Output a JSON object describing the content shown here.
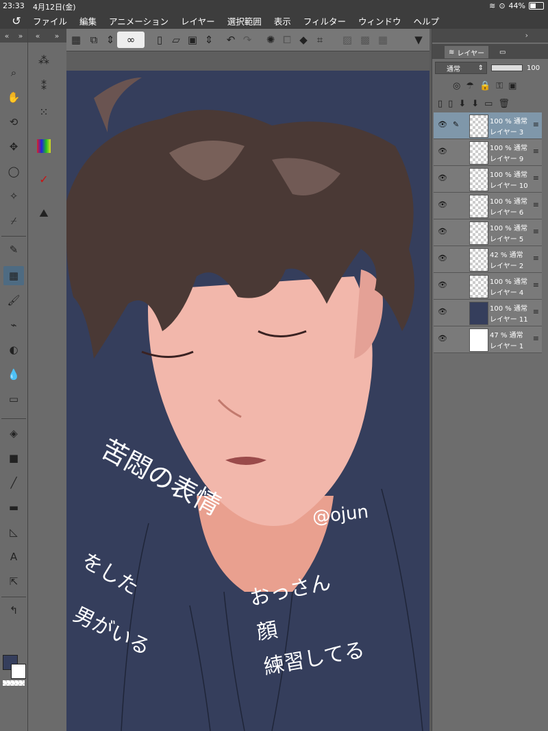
{
  "status": {
    "time": "23:33",
    "date": "4月12日(金)",
    "battery": "44%",
    "battery_level": 0.44
  },
  "menu": [
    "ファイル",
    "編集",
    "アニメーション",
    "レイヤー",
    "選択範囲",
    "表示",
    "フィルター",
    "ウィンドウ",
    "ヘルプ"
  ],
  "layer_panel": {
    "tab_label": "レイヤー",
    "blend_mode": "通常",
    "opacity": "100",
    "layers": [
      {
        "opacity": "100 %",
        "mode": "通常",
        "name": "レイヤー 3",
        "selected": true,
        "thumb": "transparent"
      },
      {
        "opacity": "100 %",
        "mode": "通常",
        "name": "レイヤー 9",
        "selected": false,
        "thumb": "transparent"
      },
      {
        "opacity": "100 %",
        "mode": "通常",
        "name": "レイヤー 10",
        "selected": false,
        "thumb": "transparent"
      },
      {
        "opacity": "100 %",
        "mode": "通常",
        "name": "レイヤー 6",
        "selected": false,
        "thumb": "transparent"
      },
      {
        "opacity": "100 %",
        "mode": "通常",
        "name": "レイヤー 5",
        "selected": false,
        "thumb": "transparent"
      },
      {
        "opacity": "42 %",
        "mode": "通常",
        "name": "レイヤー 2",
        "selected": false,
        "thumb": "transparent"
      },
      {
        "opacity": "100 %",
        "mode": "通常",
        "name": "レイヤー 4",
        "selected": false,
        "thumb": "transparent"
      },
      {
        "opacity": "100 %",
        "mode": "通常",
        "name": "レイヤー 11",
        "selected": false,
        "thumb": "navy"
      },
      {
        "opacity": "47 %",
        "mode": "通常",
        "name": "レイヤー 1",
        "selected": false,
        "thumb": "white"
      }
    ]
  },
  "tool_sidebar": {
    "tools": [
      "zoom-icon",
      "hand-icon",
      "rotate-icon",
      "move-icon",
      "lasso-icon",
      "magic-wand-icon",
      "eyedropper-icon",
      "pen-icon",
      "pattern-icon",
      "brush-icon",
      "airbrush-icon",
      "blend-icon",
      "water-drop-icon",
      "eraser-icon",
      "fill-icon",
      "gradient-icon",
      "line-icon",
      "ruler-icon",
      "triangle-ruler-icon",
      "text-icon",
      "select-object-icon",
      "correct-line-icon"
    ]
  },
  "canvas": {
    "background": "#353e5c",
    "handwriting": [
      "苦悶の表情",
      "をした",
      "男がいる",
      "おっさん",
      "顔",
      "練習してる",
      "@ojun"
    ]
  },
  "colors": {
    "main": "#353e5c",
    "sub": "#ffffff",
    "accent": "#7f97aa"
  }
}
